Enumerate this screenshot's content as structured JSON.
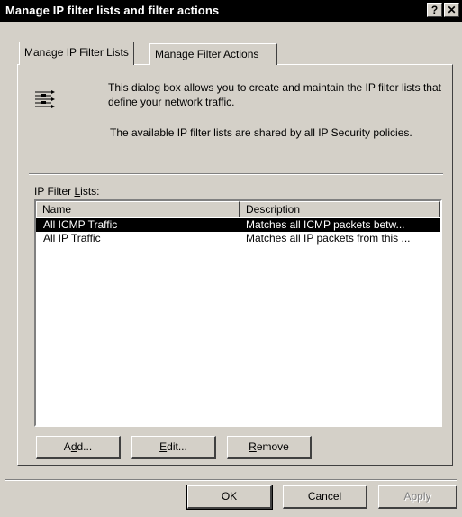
{
  "window": {
    "title": "Manage IP filter lists and filter actions",
    "help_glyph": "?",
    "close_glyph": "✕"
  },
  "tabs": [
    {
      "label": "Manage IP Filter Lists",
      "active": true
    },
    {
      "label": "Manage Filter Actions",
      "active": false
    }
  ],
  "panel": {
    "intro_text": "This dialog box allows you to create and maintain the IP filter lists that define your network traffic.",
    "shared_text": "The available IP filter lists are shared by all IP Security policies.",
    "lists_label_prefix": "IP Filter ",
    "lists_label_mnemonic": "L",
    "lists_label_suffix": "ists:"
  },
  "list": {
    "columns": [
      "Name",
      "Description"
    ],
    "rows": [
      {
        "name": "All ICMP Traffic",
        "description": "Matches all ICMP packets betw...",
        "selected": true
      },
      {
        "name": "All IP Traffic",
        "description": "Matches all IP packets from this ...",
        "selected": false
      }
    ]
  },
  "list_buttons": {
    "add_pre": "A",
    "add_mn": "d",
    "add_post": "d...",
    "edit_pre": "",
    "edit_mn": "E",
    "edit_post": "dit...",
    "remove_pre": "",
    "remove_mn": "R",
    "remove_post": "emove"
  },
  "dialog_buttons": {
    "ok": "OK",
    "cancel": "Cancel",
    "apply": "Apply"
  },
  "icons": {
    "filter": "filter-list-icon"
  },
  "colors": {
    "window_bg": "#d4d0c8",
    "titlebar_bg": "#000000",
    "selection_bg": "#000000"
  }
}
